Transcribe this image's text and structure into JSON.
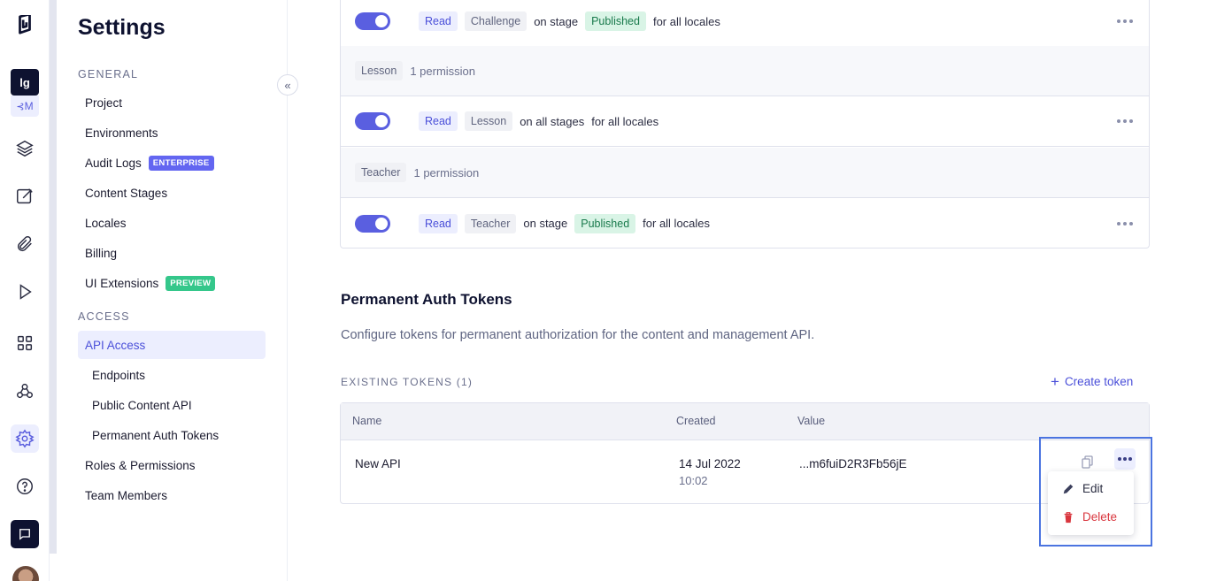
{
  "rail": {
    "project_initials": "lg",
    "project_env": "M",
    "icons": [
      "logo-icon",
      "schema-icon",
      "content-icon",
      "assets-icon",
      "playground-icon",
      "apps-icon",
      "webhooks-icon",
      "settings-icon",
      "help-icon",
      "chat-icon"
    ]
  },
  "nav": {
    "title": "Settings",
    "general_label": "GENERAL",
    "access_label": "ACCESS",
    "items": {
      "project": "Project",
      "environments": "Environments",
      "audit_logs": "Audit Logs",
      "audit_badge": "ENTERPRISE",
      "content_stages": "Content Stages",
      "locales": "Locales",
      "billing": "Billing",
      "ui_extensions": "UI Extensions",
      "ui_badge": "PREVIEW",
      "api_access": "API Access",
      "endpoints": "Endpoints",
      "public_content_api": "Public Content API",
      "permanent_auth_tokens": "Permanent Auth Tokens",
      "roles_permissions": "Roles & Permissions",
      "team_members": "Team Members"
    }
  },
  "permissions": [
    {
      "type": "rule",
      "action": "Read",
      "model": "Challenge",
      "stage_text": "on stage",
      "stage": "Published",
      "locale_text": "for all locales"
    },
    {
      "type": "group",
      "model": "Lesson",
      "count": "1 permission"
    },
    {
      "type": "rule",
      "action": "Read",
      "model": "Lesson",
      "stage_text": "on all stages",
      "stage": "",
      "locale_text": "for all locales"
    },
    {
      "type": "group",
      "model": "Teacher",
      "count": "1 permission"
    },
    {
      "type": "rule",
      "action": "Read",
      "model": "Teacher",
      "stage_text": "on stage",
      "stage": "Published",
      "locale_text": "for all locales"
    }
  ],
  "tokens_section": {
    "title": "Permanent Auth Tokens",
    "description": "Configure tokens for permanent authorization for the content and management API.",
    "existing_label": "EXISTING TOKENS (1)",
    "create_label": "Create token",
    "columns": {
      "name": "Name",
      "created": "Created",
      "value": "Value"
    },
    "rows": [
      {
        "name": "New API",
        "created_date": "14 Jul 2022",
        "created_time": "10:02",
        "value": "...m6fuiD2R3Fb56jE"
      }
    ],
    "menu": {
      "edit": "Edit",
      "delete": "Delete"
    }
  },
  "colors": {
    "accent": "#5a5fe0",
    "danger": "#d9363e",
    "published": "#d9f4e6"
  }
}
